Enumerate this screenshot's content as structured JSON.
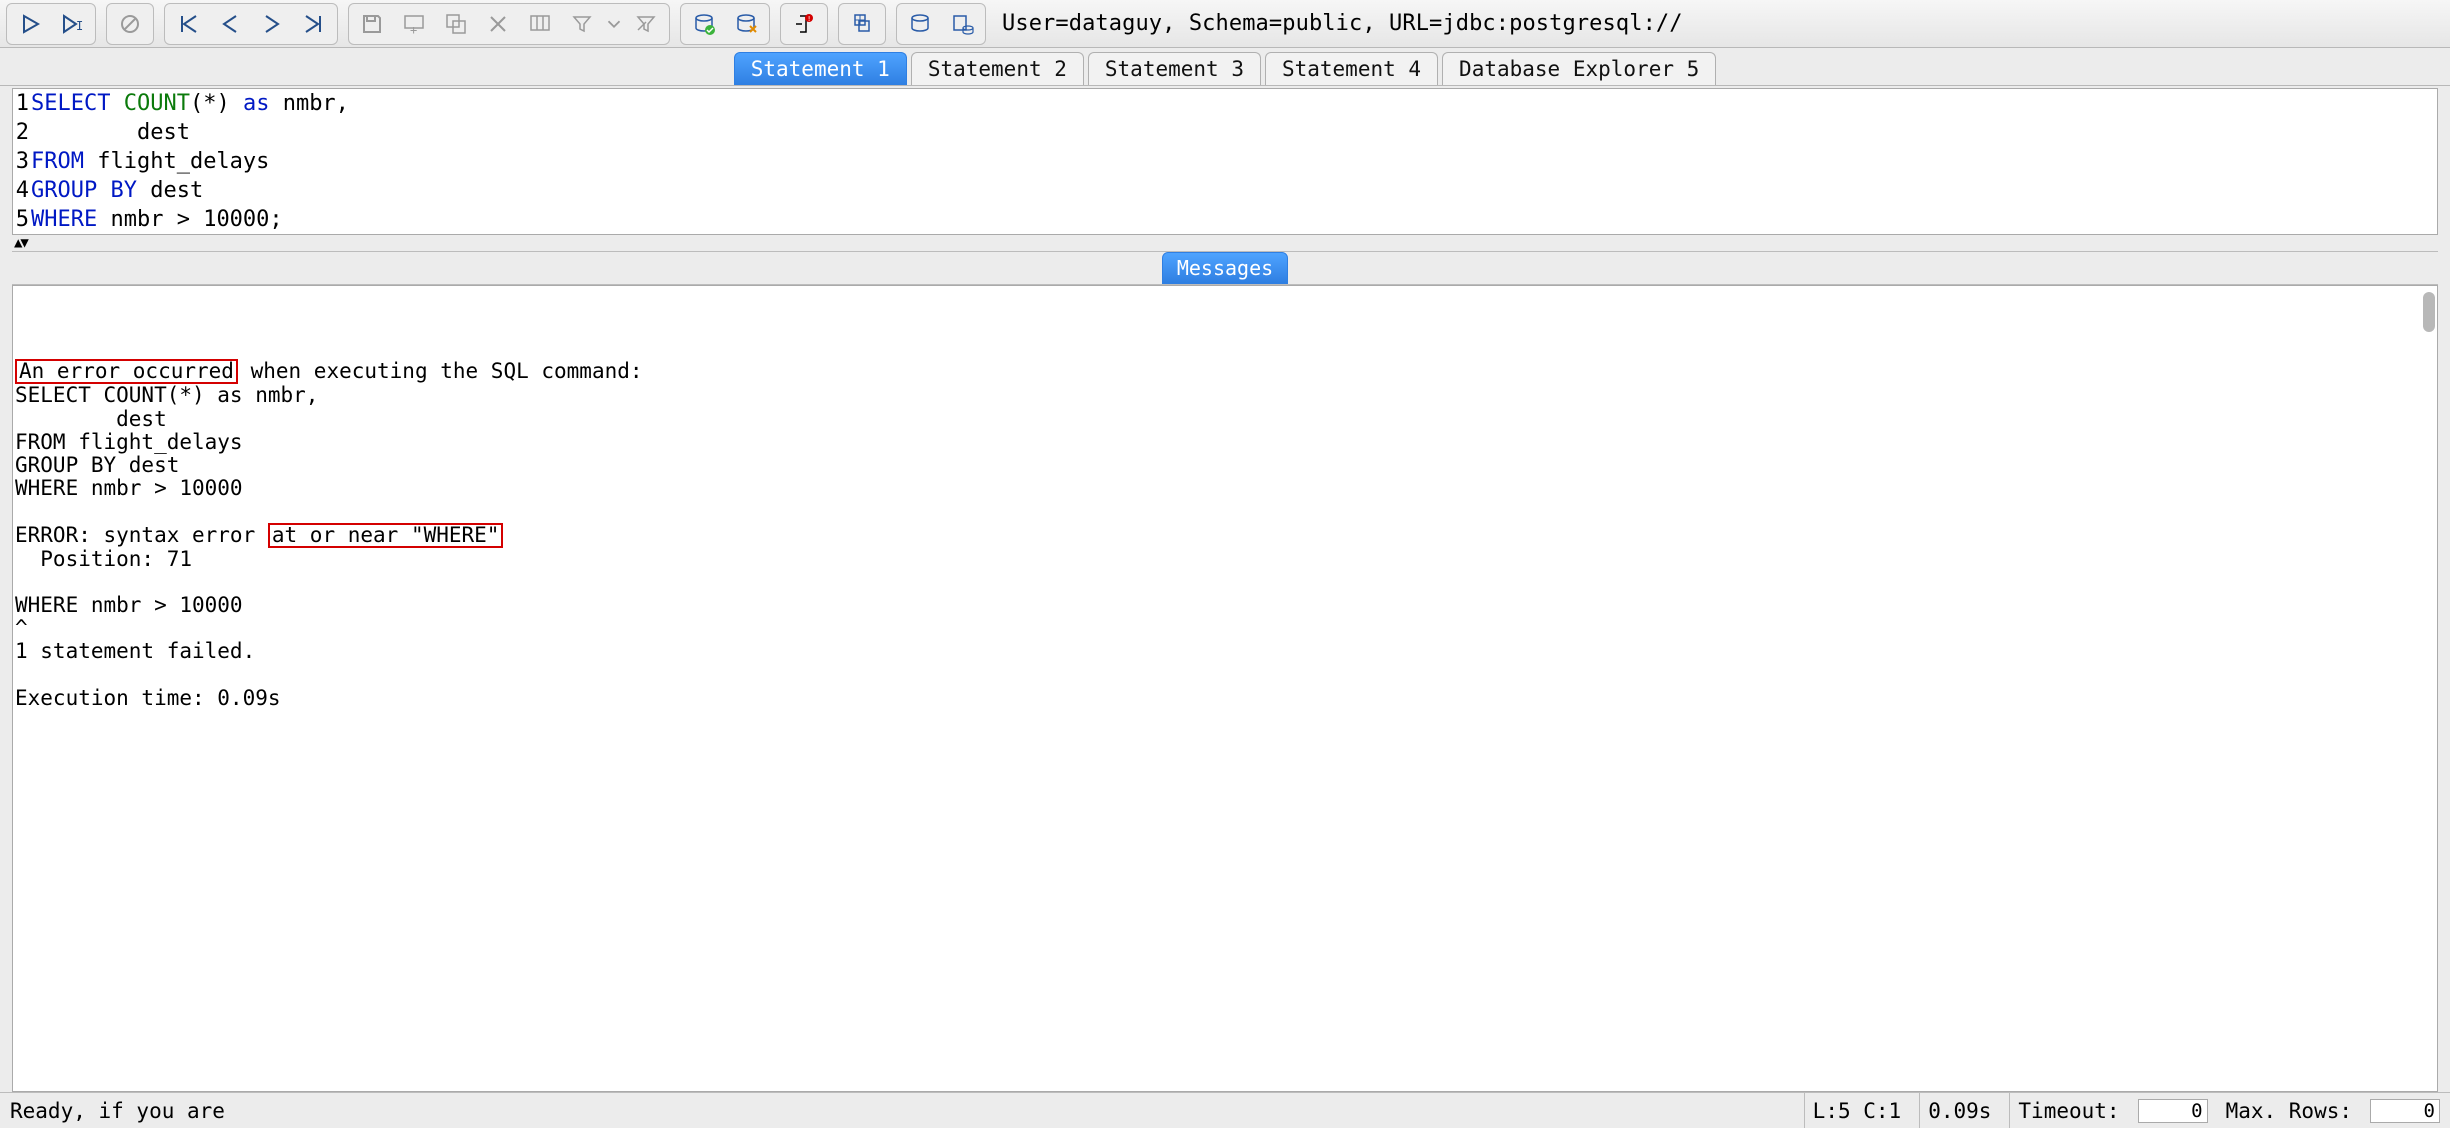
{
  "connection_label": "User=dataguy, Schema=public, URL=jdbc:postgresql://",
  "tabs": [
    {
      "label": "Statement 1",
      "active": true
    },
    {
      "label": "Statement 2",
      "active": false
    },
    {
      "label": "Statement 3",
      "active": false
    },
    {
      "label": "Statement 4",
      "active": false
    },
    {
      "label": "Database Explorer 5",
      "active": false
    }
  ],
  "editor_lines": [
    {
      "num": "1",
      "tokens": [
        [
          "SELECT",
          "kw-blue"
        ],
        [
          " ",
          ""
        ],
        [
          "COUNT",
          "kw-green"
        ],
        [
          "(*) ",
          ""
        ],
        [
          "as",
          "kw-blue"
        ],
        [
          " nmbr,",
          ""
        ]
      ]
    },
    {
      "num": "2",
      "tokens": [
        [
          "        dest",
          ""
        ]
      ]
    },
    {
      "num": "3",
      "tokens": [
        [
          "FROM",
          "kw-blue"
        ],
        [
          " flight_delays",
          ""
        ]
      ]
    },
    {
      "num": "4",
      "tokens": [
        [
          "GROUP BY",
          "kw-blue"
        ],
        [
          " dest",
          ""
        ]
      ]
    },
    {
      "num": "5",
      "tokens": [
        [
          "WHERE",
          "kw-blue"
        ],
        [
          " nmbr > 10000;",
          ""
        ]
      ]
    }
  ],
  "messages_tab_label": "Messages",
  "messages": {
    "err_phrase": "An error occurred",
    "after_err": " when executing the SQL command:",
    "echo": "SELECT COUNT(*) as nmbr,\n        dest\nFROM flight_delays\nGROUP BY dest\nWHERE nmbr > 10000",
    "error_prefix": "ERROR: syntax error ",
    "error_hl": "at or near \"WHERE\"",
    "position_line": "  Position: 71",
    "where_echo": "WHERE nmbr > 10000",
    "caret": "^",
    "failed": "1 statement failed.",
    "exec_time": "Execution time: 0.09s"
  },
  "status": {
    "ready": "Ready, if you are",
    "cursor": "L:5 C:1",
    "time": "0.09s",
    "timeout_label": "Timeout:",
    "timeout_val": "0",
    "maxrows_label": "Max. Rows:",
    "maxrows_val": "0"
  }
}
